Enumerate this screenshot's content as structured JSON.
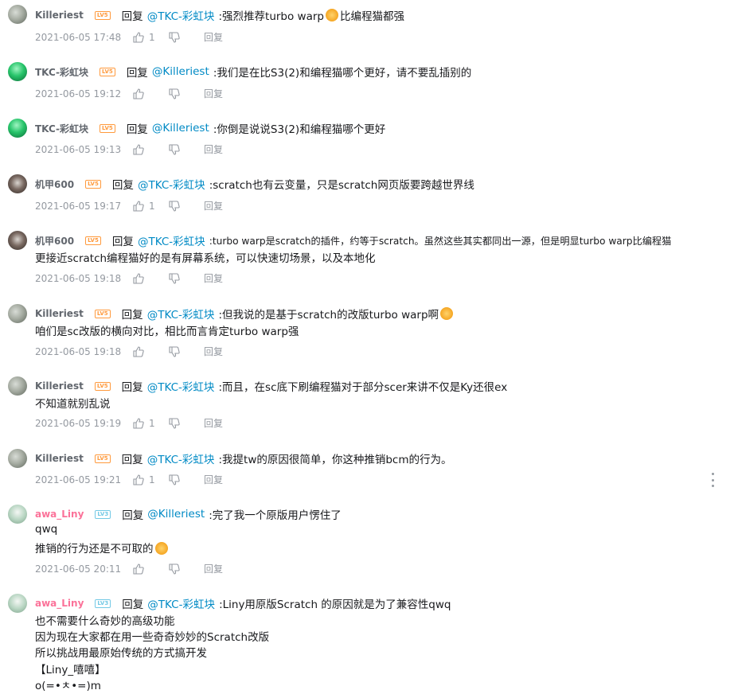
{
  "reply_prefix": "回复",
  "reply_action": "回复",
  "replies": [
    {
      "user": "Killeriest",
      "level": "LV5",
      "target": "@TKC-彩虹块",
      "text": ":强烈推荐turbo warp",
      "suffix": "比编程猫都强",
      "extra": [],
      "time": "2021-06-05 17:48",
      "likes": "1"
    },
    {
      "user": "TKC-彩虹块",
      "level": "LV5",
      "target": "@Killeriest",
      "text": ":我们是在比S3(2)和编程猫哪个更好，请不要乱插别的",
      "suffix": "",
      "extra": [],
      "time": "2021-06-05 19:12",
      "likes": ""
    },
    {
      "user": "TKC-彩虹块",
      "level": "LV5",
      "target": "@Killeriest",
      "text": ":你倒是说说S3(2)和编程猫哪个更好",
      "suffix": "",
      "extra": [],
      "time": "2021-06-05 19:13",
      "likes": ""
    },
    {
      "user": "机甲600",
      "level": "LV5",
      "target": "@TKC-彩虹块",
      "text": ":scratch也有云变量，只是scratch网页版要跨越世界线",
      "suffix": "",
      "extra": [],
      "time": "2021-06-05 19:17",
      "likes": "1"
    },
    {
      "user": "机甲600",
      "level": "LV5",
      "target": "@TKC-彩虹块",
      "text": ":turbo warp是scratch的插件，约等于scratch。虽然这些其实都同出一源，但是明显turbo warp比编程猫",
      "suffix": "",
      "extra": [
        "更接近scratch编程猫好的是有屏幕系统，可以快速切场景，以及本地化"
      ],
      "time": "2021-06-05 19:18",
      "likes": ""
    },
    {
      "user": "Killeriest",
      "level": "LV5",
      "target": "@TKC-彩虹块",
      "text": ":但我说的是基于scratch的改版turbo warp啊",
      "suffix": "",
      "extra": [
        "咱们是sc改版的横向对比，相比而言肯定turbo warp强"
      ],
      "time": "2021-06-05 19:18",
      "likes": ""
    },
    {
      "user": "Killeriest",
      "level": "LV5",
      "target": "@TKC-彩虹块",
      "text": ":而且，在sc底下刷编程猫对于部分scer来讲不仅是Ky还很ex",
      "suffix": "",
      "extra": [
        "不知道就别乱说"
      ],
      "time": "2021-06-05 19:19",
      "likes": "1"
    },
    {
      "user": "Killeriest",
      "level": "LV5",
      "target": "@TKC-彩虹块",
      "text": ":我提tw的原因很简单，你这种推销bcm的行为。",
      "suffix": "",
      "extra": [],
      "time": "2021-06-05 19:21",
      "likes": "1"
    },
    {
      "user": "awa_Liny",
      "level": "LV3",
      "target": "@Killeriest",
      "text": ":完了我一个原版用户愣住了",
      "suffix": "",
      "extra": [
        "qwq",
        "推销的行为还是不可取的"
      ],
      "time": "2021-06-05 20:11",
      "likes": ""
    },
    {
      "user": "awa_Liny",
      "level": "LV3",
      "target": "@TKC-彩虹块",
      "text": ":Liny用原版Scratch 的原因就是为了兼容性qwq",
      "suffix": "",
      "extra": [
        "也不需要什么奇妙的高级功能",
        "因为现在大家都在用一些奇奇妙妙的Scratch改版",
        "所以挑战用最原始传统的方式搞开发",
        "【Liny_嘻嘻】",
        "o(=•ㅊ•=)m"
      ],
      "time": "",
      "likes": ""
    }
  ],
  "colors": {
    "accent": "#008ac5",
    "muted": "#9499a0",
    "level_orange": "#ff9a3d",
    "level_blue": "#73c9e5",
    "name_pink": "#fb7299"
  },
  "icons": {
    "like": "thumb-up-icon",
    "dislike": "thumb-down-icon",
    "more": "more-vertical-icon"
  }
}
